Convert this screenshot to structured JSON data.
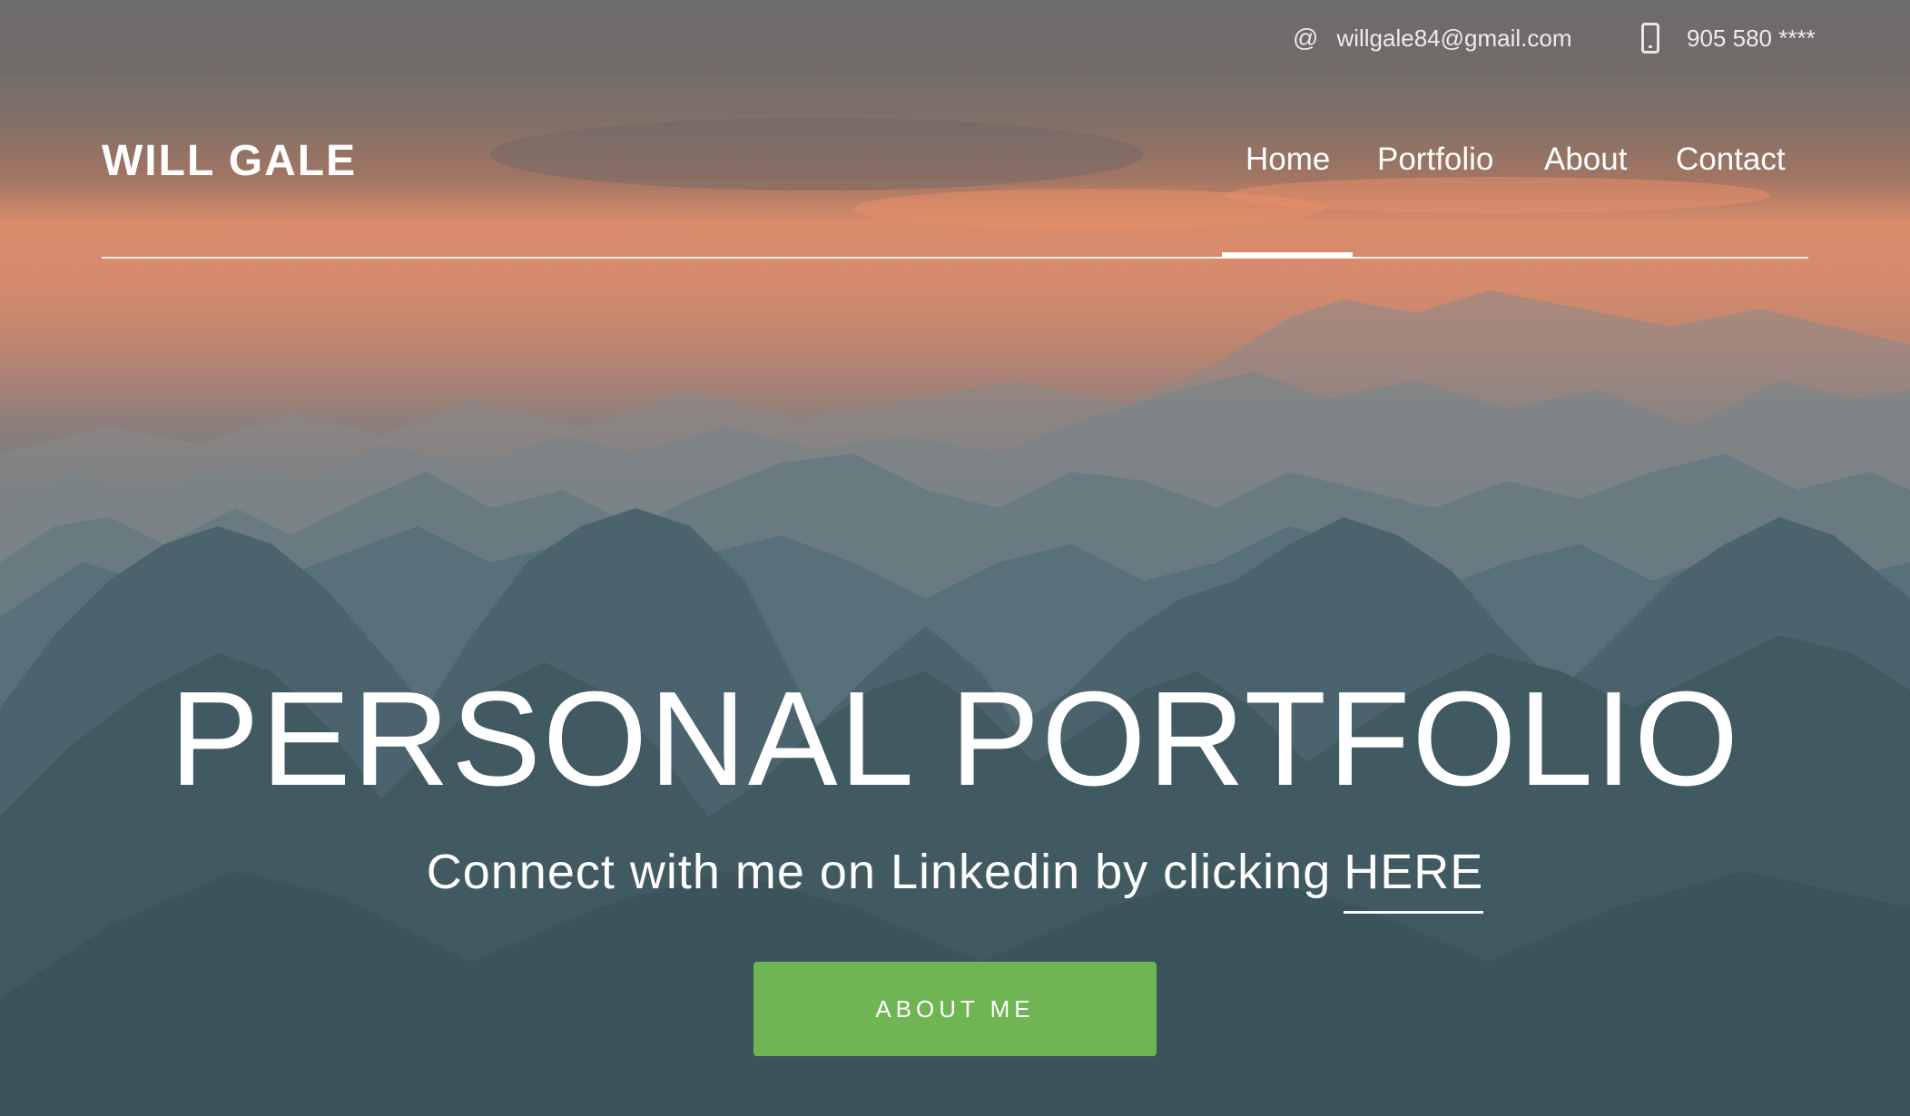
{
  "topbar": {
    "email": "willgale84@gmail.com",
    "email_icon": "@",
    "phone": "905 580 ****",
    "phone_icon_name": "mobile-phone-icon"
  },
  "header": {
    "brand": "WILL GALE"
  },
  "nav": {
    "items": [
      {
        "label": "Home",
        "active": true
      },
      {
        "label": "Portfolio",
        "active": false
      },
      {
        "label": "About",
        "active": false
      },
      {
        "label": "Contact",
        "active": false
      }
    ]
  },
  "hero": {
    "title": "PERSONAL PORTFOLIO",
    "subtitle_prefix": "Connect with me on Linkedin by clicking",
    "subtitle_link": "HERE",
    "button_label": "ABOUT ME"
  },
  "colors": {
    "accent_button": "#6fb553",
    "text": "#ffffff"
  }
}
